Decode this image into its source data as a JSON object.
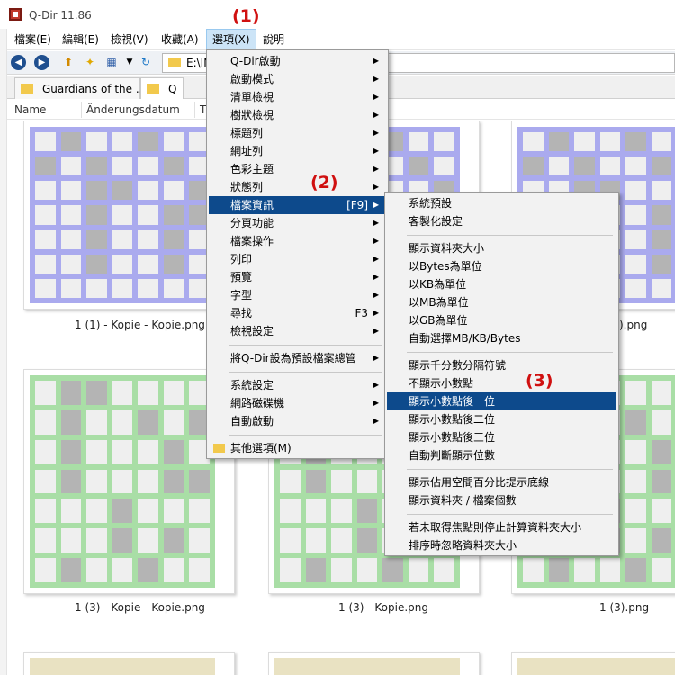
{
  "window": {
    "title": "Q-Dir 11.86"
  },
  "callouts": [
    "(1)",
    "(2)",
    "(3)"
  ],
  "menubar": [
    "檔案(E)",
    "編輯(E)",
    "檢視(V)",
    "收藏(A)",
    "選項(X)",
    "說明"
  ],
  "address": {
    "path": "E:\\INI"
  },
  "tabs": [
    "Guardians of the ...",
    "Q"
  ],
  "columns": [
    "Name",
    "Änderungsdatum",
    "T"
  ],
  "files": [
    {
      "name": "1 (1) - Kopie - Kopie.png",
      "color": "#aaaaee"
    },
    {
      "name": "",
      "color": "#aaaaee"
    },
    {
      "name": ").png",
      "color": "#aaaaee"
    },
    {
      "name": "1 (3) - Kopie - Kopie.png",
      "color": "#a9dea6"
    },
    {
      "name": "1 (3) - Kopie.png",
      "color": "#a9dea6"
    },
    {
      "name": "1 (3).png",
      "color": "#a9dea6"
    }
  ],
  "options_menu": {
    "items": [
      {
        "label": "Q-Dir啟動",
        "arrow": true
      },
      {
        "label": "啟動模式",
        "arrow": true
      },
      {
        "label": "清單檢視",
        "arrow": true
      },
      {
        "label": "樹狀檢視",
        "arrow": true
      },
      {
        "label": "標題列",
        "arrow": true
      },
      {
        "label": "網址列",
        "arrow": true
      },
      {
        "label": "色彩主題",
        "arrow": true
      },
      {
        "label": "狀態列",
        "arrow": true
      },
      {
        "label": "檔案資訊",
        "shortcut": "[F9]",
        "arrow": true,
        "highlight": true
      },
      {
        "label": "分頁功能",
        "arrow": true
      },
      {
        "label": "檔案操作",
        "arrow": true
      },
      {
        "label": "列印",
        "arrow": true
      },
      {
        "label": "預覽",
        "arrow": true
      },
      {
        "label": "字型",
        "arrow": true
      },
      {
        "label": "尋找",
        "shortcut": "F3",
        "arrow": true
      },
      {
        "label": "檢視設定",
        "arrow": true
      },
      {
        "separator": true
      },
      {
        "label": "將Q-Dir設為預設檔案總管",
        "arrow": true
      },
      {
        "separator": true
      },
      {
        "label": "系統設定",
        "arrow": true
      },
      {
        "label": "網路磁碟機",
        "arrow": true
      },
      {
        "label": "自動啟動",
        "arrow": true
      },
      {
        "separator": true
      },
      {
        "label": "其他選項(M)",
        "folder": true
      }
    ]
  },
  "file_info_menu": {
    "items": [
      {
        "label": "系統預設"
      },
      {
        "label": "客製化設定"
      },
      {
        "separator": true
      },
      {
        "label": "顯示資料夾大小"
      },
      {
        "label": "以Bytes為單位"
      },
      {
        "label": "以KB為單位"
      },
      {
        "label": "以MB為單位"
      },
      {
        "label": "以GB為單位"
      },
      {
        "label": "自動選擇MB/KB/Bytes"
      },
      {
        "separator": true
      },
      {
        "label": "顯示千分數分隔符號"
      },
      {
        "label": "不顯示小數點"
      },
      {
        "label": "顯示小數點後一位",
        "highlight": true
      },
      {
        "label": "顯示小數點後二位"
      },
      {
        "label": "顯示小數點後三位"
      },
      {
        "label": "自動判斷顯示位數"
      },
      {
        "separator": true
      },
      {
        "label": "顯示佔用空間百分比提示底線"
      },
      {
        "label": "顯示資料夾 / 檔案個數"
      },
      {
        "separator": true
      },
      {
        "label": "若未取得焦點則停止計算資料夾大小"
      },
      {
        "label": "排序時忽略資料夾大小"
      }
    ]
  }
}
